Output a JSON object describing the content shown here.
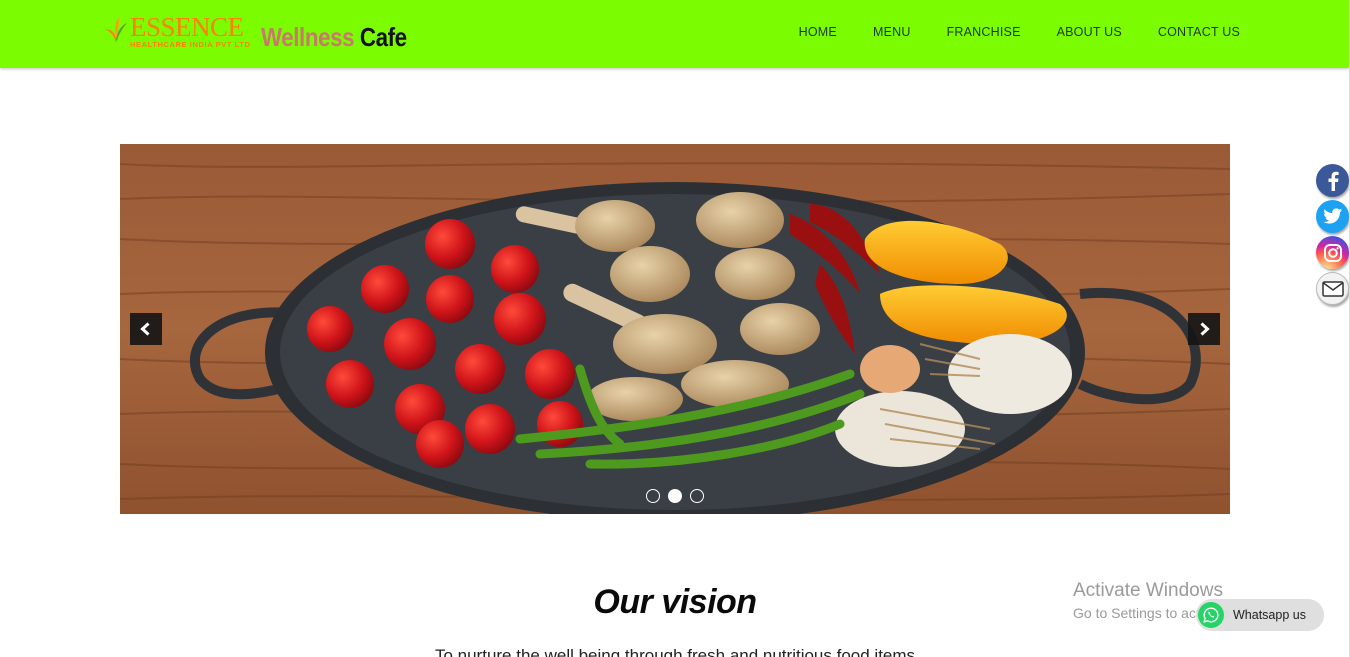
{
  "header": {
    "logo": {
      "essence": "ESSENCE",
      "essence_sub": "HEALTHCARE INDIA PVT LTD",
      "wellness": "Wellness",
      "cafe": "Cafe"
    },
    "nav": [
      "HOME",
      "MENU",
      "FRANCHISE",
      "ABOUT US",
      "CONTACT US"
    ],
    "background_color": "#7cfc00"
  },
  "carousel": {
    "slide_count": 3,
    "active_index": 1,
    "slide_image": "vegetables-on-pan",
    "prev_icon": "chevron-left-icon",
    "next_icon": "chevron-right-icon"
  },
  "social": [
    {
      "name": "facebook",
      "icon": "facebook-icon",
      "color": "#3b5998"
    },
    {
      "name": "twitter",
      "icon": "twitter-icon",
      "color": "#1da1f2"
    },
    {
      "name": "instagram",
      "icon": "instagram-icon",
      "color": "#d6249f"
    },
    {
      "name": "mail",
      "icon": "mail-icon",
      "color": "#f2f2f2"
    }
  ],
  "vision": {
    "title": "Our vision",
    "text": "To nurture the well being through fresh and nutritious food items"
  },
  "watermark": {
    "line1": "Activate Windows",
    "line2": "Go to Settings to activate Windows."
  },
  "whatsapp": {
    "label": "Whatsapp us",
    "icon": "whatsapp-icon"
  }
}
